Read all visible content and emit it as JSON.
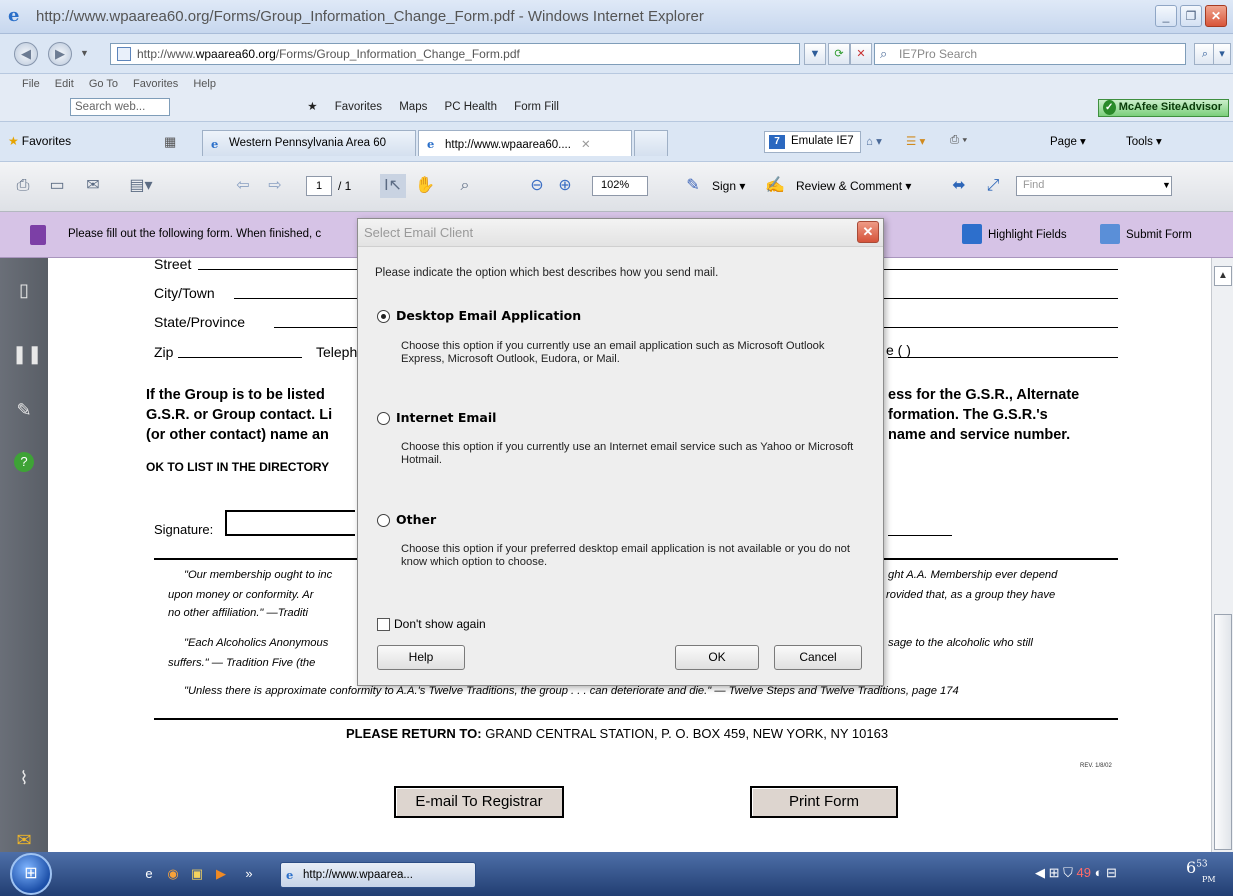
{
  "window": {
    "title": "http://www.wpaarea60.org/Forms/Group_Information_Change_Form.pdf - Windows Internet Explorer"
  },
  "address_bar": {
    "url_prefix": "http://www.",
    "url_domain": "wpaarea60.org",
    "url_path": "/Forms/Group_Information_Change_Form.pdf",
    "search_placeholder": "IE7Pro Search"
  },
  "menu": {
    "items": [
      "File",
      "Edit",
      "Go To",
      "Favorites",
      "Help"
    ],
    "web_search_placeholder": "Search web...",
    "toolbar_items": [
      "Favorites",
      "Maps",
      "PC Health",
      "Form Fill"
    ],
    "mcafee": "McAfee SiteAdvisor"
  },
  "tabs": {
    "favorites_label": "Favorites",
    "tab1": "Western Pennsylvania Area 60",
    "tab2": "http://www.wpaarea60....",
    "emulate": "Emulate IE7",
    "page_menu": "Page",
    "tools_menu": "Tools"
  },
  "acrobat": {
    "page_current": "1",
    "page_total": "/ 1",
    "zoom": "102%",
    "sign": "Sign",
    "review": "Review & Comment",
    "find_placeholder": "Find"
  },
  "formbar": {
    "message": "Please fill out the following form. When finished, c",
    "highlight": "Highlight Fields",
    "submit": "Submit Form"
  },
  "document": {
    "street": "Street",
    "city": "City/Town",
    "state": "State/Province",
    "zip": "Zip",
    "telephone": "Teleph",
    "phone_paren": "e (        )",
    "bold_left": [
      "If the Group is to be listed",
      "G.S.R. or Group contact. Li",
      "(or other contact) name an"
    ],
    "bold_right": [
      "ess for the G.S.R., Alternate",
      "formation. The G.S.R.'s",
      "name and service number."
    ],
    "ok_list": "OK TO LIST IN THE DIRECTORY",
    "signature": "Signature:",
    "quotes_left": [
      "\"Our membership ought to inc",
      "upon money or conformity. Ar",
      "no other affiliation.\"  —Traditi",
      "\"Each Alcoholics Anonymous",
      "suffers.\" — Tradition Five (the",
      "\"Unless there is approximate conformity to A.A.'s Twelve Traditions, the group . . . can deteriorate and die.\"  — Twelve Steps and Twelve Traditions, page 174"
    ],
    "quotes_right": [
      "ght A.A. Membership ever depend",
      "rovided that, as a group they have",
      "sage to the alcoholic who still"
    ],
    "return_label": "PLEASE RETURN TO:",
    "return_address": "GRAND CENTRAL STATION, P. O. BOX 459, NEW YORK, NY 10163",
    "rev": "REV. 1/8/02",
    "email_button": "E-mail To Registrar",
    "print_button": "Print Form"
  },
  "dialog": {
    "title": "Select Email Client",
    "instruction": "Please indicate the option which best describes how you send mail.",
    "options": [
      {
        "label": "Desktop Email Application",
        "desc": "Choose this option if you currently use an email application such as Microsoft Outlook Express, Microsoft Outlook, Eudora, or Mail.",
        "selected": true
      },
      {
        "label": "Internet Email",
        "desc": "Choose this option if you currently use an Internet email service such as Yahoo or Microsoft Hotmail.",
        "selected": false
      },
      {
        "label": "Other",
        "desc": "Choose this option if your preferred desktop email application is not available or you do not know which option to choose.",
        "selected": false
      }
    ],
    "dont_show": "Don't show again",
    "help": "Help",
    "ok": "OK",
    "cancel": "Cancel"
  },
  "taskbar": {
    "item": "http://www.wpaarea...",
    "tray_count": "49",
    "clock_hour": "6",
    "clock_min": "53",
    "clock_ampm": "PM"
  }
}
